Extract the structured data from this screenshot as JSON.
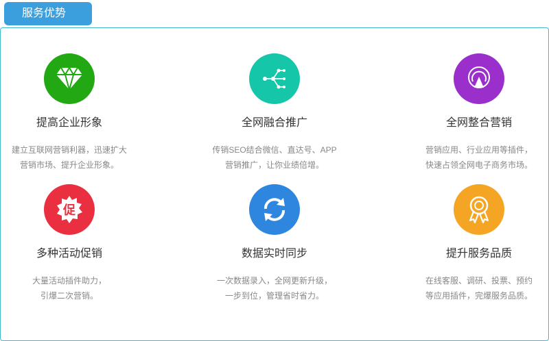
{
  "section": {
    "title": "服务优势"
  },
  "colors": {
    "tab": "#3b9fdd",
    "border": "#3fb9c9",
    "green": "#22a812",
    "teal": "#16c6a9",
    "purple": "#9b2fcb",
    "red": "#ea3040",
    "blue": "#2e86df",
    "orange": "#f5a524"
  },
  "features": [
    {
      "icon": "diamond-icon",
      "title": "提高企业形象",
      "desc": [
        "建立互联网营销利器，迅速扩大",
        "营销市场、提升企业形象。"
      ]
    },
    {
      "icon": "network-icon",
      "title": "全网融合推广",
      "desc": [
        "传销SEO结合微信、直达号、APP",
        "营销推广，让你业绩倍增。"
      ]
    },
    {
      "icon": "signal-icon",
      "title": "全网整合营销",
      "desc": [
        "营销应用、行业应用等插件，",
        "快速占领全网电子商务市场。"
      ]
    },
    {
      "icon": "promo-badge-icon",
      "badge": "促",
      "title": "多种活动促销",
      "desc": [
        "大量活动插件助力，",
        "引爆二次营销。"
      ]
    },
    {
      "icon": "sync-icon",
      "title": "数据实时同步",
      "desc": [
        "一次数据录入，全网更新升级，",
        "一步到位，管理省时省力。"
      ]
    },
    {
      "icon": "award-icon",
      "title": "提升服务品质",
      "desc": [
        "在线客服、调研、投票、预约",
        "等应用插件，完爆服务品质。"
      ]
    }
  ]
}
